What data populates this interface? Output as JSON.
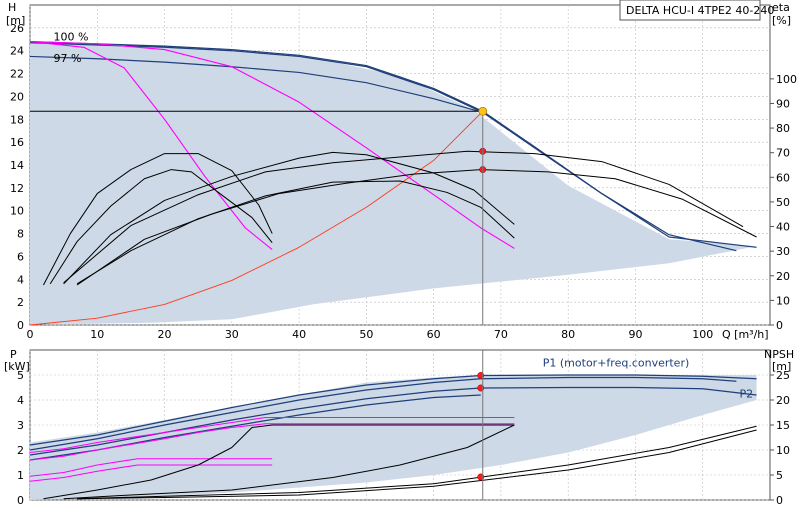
{
  "chart_data": [
    {
      "type": "line",
      "title": "DELTA HCU-I 4TPE2 40-240",
      "ylabel": "H",
      "yunit": "[m]",
      "xlabel": "Q [m³/h]",
      "y2label": "eta",
      "y2unit": "[%]",
      "xlim": [
        0,
        110
      ],
      "ylim": [
        0,
        28
      ],
      "y2lim": [
        0,
        130
      ],
      "xticks": [
        0,
        10,
        20,
        30,
        40,
        50,
        60,
        70,
        80,
        90,
        100
      ],
      "yticks": [
        0,
        2,
        4,
        6,
        8,
        10,
        12,
        14,
        16,
        18,
        20,
        22,
        24,
        26
      ],
      "y2ticks": [
        0,
        10,
        20,
        30,
        40,
        50,
        60,
        70,
        80,
        90,
        100
      ],
      "grid": true,
      "colors": {
        "envelope": "#cdd9e6",
        "curve": "#1f3f7a",
        "eta": "#ff00ff",
        "system": "#ff3b1f",
        "dot": "#ff1a1a",
        "duty": "#ffc21a"
      },
      "annotations": [
        {
          "text": "100 %",
          "x": 3.5,
          "y": 24.9
        },
        {
          "text": "97 %",
          "x": 3.5,
          "y": 23.0
        }
      ],
      "envelope": {
        "x": [
          0,
          2,
          7,
          18,
          30,
          42,
          55,
          66,
          80,
          95,
          108,
          108,
          95,
          80,
          60,
          42,
          30,
          18,
          8,
          3,
          2,
          0
        ],
        "y": [
          24.8,
          24.8,
          24.6,
          24.3,
          24.0,
          23.4,
          21.8,
          18.8,
          12.2,
          7.5,
          6.9,
          6.9,
          5.4,
          4.4,
          3.2,
          1.8,
          0.5,
          0.2,
          0.1,
          0.1,
          0.05,
          0
        ]
      },
      "duty_point": {
        "x": 67.3,
        "y": 18.7
      },
      "points": [
        {
          "x": 67.3,
          "y": 15.2
        },
        {
          "x": 67.3,
          "y": 13.6
        }
      ],
      "series": [
        {
          "role": "curve",
          "x": [
            0,
            10,
            20,
            30,
            40,
            50,
            60,
            67.3,
            75,
            85,
            95,
            105
          ],
          "y": [
            24.8,
            24.6,
            24.4,
            24.1,
            23.6,
            22.7,
            20.7,
            18.7,
            15.6,
            11.5,
            7.9,
            6.5
          ]
        },
        {
          "role": "curve",
          "x": [
            0,
            10,
            20,
            30,
            40,
            50,
            60,
            67.3,
            75,
            85,
            95,
            108
          ],
          "y": [
            24.7,
            24.5,
            24.3,
            24.0,
            23.5,
            22.6,
            20.6,
            18.6,
            15.5,
            11.5,
            7.7,
            6.8
          ]
        },
        {
          "role": "curve",
          "x": [
            0,
            10,
            20,
            30,
            40,
            50,
            60,
            67.3
          ],
          "y": [
            23.5,
            23.3,
            23.0,
            22.6,
            22.1,
            21.2,
            19.8,
            18.6
          ]
        },
        {
          "role": "system",
          "x": [
            0,
            10,
            20,
            30,
            40,
            50,
            60,
            67.3
          ],
          "y": [
            0,
            0.6,
            1.8,
            3.9,
            6.8,
            10.3,
            14.4,
            18.7
          ]
        },
        {
          "role": "eta",
          "x": [
            0,
            8,
            14,
            20,
            26,
            32,
            36
          ],
          "y": [
            24.8,
            24.3,
            22.5,
            18.0,
            13.0,
            8.5,
            6.6
          ]
        },
        {
          "role": "eta",
          "x": [
            0,
            10,
            20,
            30,
            40,
            50,
            60,
            67,
            72
          ],
          "y": [
            24.8,
            24.6,
            24.1,
            22.6,
            19.5,
            15.5,
            11.4,
            8.5,
            6.7
          ]
        },
        {
          "role": "eta-cur",
          "x": [
            2,
            6,
            10,
            15,
            20,
            25,
            30,
            34,
            36
          ],
          "y": [
            3.5,
            8.0,
            11.5,
            13.6,
            15.0,
            15.0,
            13.5,
            10.5,
            8.0
          ]
        },
        {
          "role": "eta-cur",
          "x": [
            3,
            7,
            12,
            17,
            21,
            24,
            28,
            33,
            36
          ],
          "y": [
            3.6,
            7.3,
            10.4,
            12.8,
            13.6,
            13.4,
            11.6,
            9.4,
            7.2
          ]
        },
        {
          "role": "eta-cur",
          "x": [
            5,
            12,
            20,
            30,
            40,
            45,
            50,
            60,
            66,
            72
          ],
          "y": [
            3.6,
            7.9,
            10.9,
            13.0,
            14.6,
            15.1,
            14.9,
            13.3,
            11.8,
            8.8
          ]
        },
        {
          "role": "eta-cur",
          "x": [
            7,
            15,
            25,
            35,
            45,
            55,
            62,
            67,
            72
          ],
          "y": [
            3.6,
            6.5,
            9.3,
            11.3,
            12.5,
            12.6,
            11.6,
            10.3,
            7.6
          ]
        },
        {
          "role": "eta-cur",
          "x": [
            5,
            15,
            25,
            35,
            45,
            55,
            65,
            75,
            85,
            95,
            106
          ],
          "y": [
            3.7,
            8.7,
            11.4,
            13.4,
            14.2,
            14.7,
            15.2,
            15.0,
            14.3,
            12.3,
            8.6
          ]
        },
        {
          "role": "eta-cur",
          "x": [
            7,
            17,
            27,
            37,
            47,
            57,
            67,
            77,
            87,
            97,
            108
          ],
          "y": [
            3.5,
            7.5,
            9.7,
            11.5,
            12.4,
            13.2,
            13.6,
            13.4,
            12.8,
            11.0,
            7.7
          ]
        }
      ]
    },
    {
      "type": "line",
      "ylabel": "P",
      "yunit": "[kW]",
      "y2label": "NPSH",
      "y2unit": "[m]",
      "xlim": [
        0,
        110
      ],
      "ylim": [
        0,
        6
      ],
      "y2lim": [
        0,
        30
      ],
      "yticks": [
        0,
        1,
        2,
        3,
        4,
        5
      ],
      "y2ticks": [
        0,
        5,
        10,
        15,
        20,
        25
      ],
      "grid": true,
      "legend": [
        {
          "text": "P1 (motor+freq.converter)",
          "x": 98,
          "y": 5.35
        },
        {
          "text": "P2",
          "x": 107.5,
          "y": 4.1
        }
      ],
      "envelope": {
        "x": [
          0,
          10,
          20,
          30,
          40,
          50,
          60,
          67,
          80,
          95,
          108,
          108,
          100,
          90,
          80,
          70,
          60,
          50,
          40,
          30,
          20,
          10,
          0
        ],
        "y": [
          2.3,
          2.7,
          3.2,
          3.7,
          4.2,
          4.7,
          4.9,
          5.0,
          5.0,
          5.0,
          5.0,
          4.0,
          3.4,
          2.6,
          1.9,
          1.4,
          1.0,
          0.7,
          0.5,
          0.3,
          0.15,
          0.05,
          0
        ]
      },
      "points": [
        {
          "x": 67,
          "y": 4.98
        },
        {
          "x": 67,
          "y": 4.48
        },
        {
          "x": 67,
          "y": 0.92
        }
      ],
      "series": [
        {
          "role": "curve",
          "x": [
            0,
            10,
            20,
            30,
            40,
            50,
            60,
            67,
            80,
            90,
            100,
            108
          ],
          "y": [
            2.2,
            2.6,
            3.15,
            3.7,
            4.2,
            4.6,
            4.85,
            4.98,
            5.0,
            5.0,
            4.95,
            4.85
          ]
        },
        {
          "role": "curve",
          "x": [
            0,
            10,
            20,
            30,
            40,
            50,
            60,
            67,
            80,
            90,
            100,
            105
          ],
          "y": [
            2.0,
            2.45,
            3.0,
            3.5,
            4.0,
            4.4,
            4.7,
            4.85,
            4.9,
            4.9,
            4.85,
            4.75
          ]
        },
        {
          "role": "curve",
          "x": [
            0,
            10,
            20,
            30,
            40,
            50,
            60,
            67,
            80,
            90,
            100,
            108
          ],
          "y": [
            1.8,
            2.2,
            2.7,
            3.2,
            3.65,
            4.05,
            4.35,
            4.48,
            4.5,
            4.5,
            4.45,
            4.2
          ]
        },
        {
          "role": "curve",
          "x": [
            0,
            10,
            20,
            30,
            40,
            50,
            60,
            67
          ],
          "y": [
            1.6,
            2.0,
            2.5,
            2.95,
            3.4,
            3.8,
            4.1,
            4.2
          ]
        },
        {
          "role": "eta",
          "x": [
            0,
            5,
            10,
            20,
            25,
            30,
            35,
            72
          ],
          "y": [
            1.9,
            2.05,
            2.3,
            2.7,
            2.9,
            3.1,
            3.3,
            3.3
          ]
        },
        {
          "role": "eta",
          "x": [
            0,
            5,
            10,
            20,
            25,
            30,
            35,
            72
          ],
          "y": [
            1.6,
            1.75,
            2.0,
            2.45,
            2.7,
            2.9,
            3.05,
            3.05
          ]
        },
        {
          "role": "eta",
          "x": [
            0,
            5,
            10,
            16,
            36
          ],
          "y": [
            0.95,
            1.1,
            1.4,
            1.65,
            1.65
          ]
        },
        {
          "role": "eta",
          "x": [
            0,
            5,
            10,
            16,
            36
          ],
          "y": [
            0.75,
            0.9,
            1.15,
            1.4,
            1.4
          ]
        },
        {
          "role": "npsh",
          "x": [
            2,
            10,
            18,
            25,
            30,
            33,
            36,
            72
          ],
          "y": [
            0.05,
            0.4,
            0.8,
            1.4,
            2.1,
            2.9,
            3.0,
            3.0
          ]
        },
        {
          "role": "npsh",
          "x": [
            5,
            15,
            30,
            45,
            55,
            65,
            72
          ],
          "y": [
            0.05,
            0.2,
            0.4,
            0.9,
            1.4,
            2.1,
            3.0
          ]
        },
        {
          "role": "npsh",
          "x": [
            7,
            20,
            40,
            60,
            80,
            95,
            108
          ],
          "y": [
            0.05,
            0.15,
            0.3,
            0.65,
            1.4,
            2.1,
            2.95
          ]
        },
        {
          "role": "npsh",
          "x": [
            7,
            20,
            40,
            60,
            80,
            95,
            108
          ],
          "y": [
            0.05,
            0.1,
            0.2,
            0.55,
            1.2,
            1.9,
            2.8
          ]
        }
      ]
    }
  ]
}
